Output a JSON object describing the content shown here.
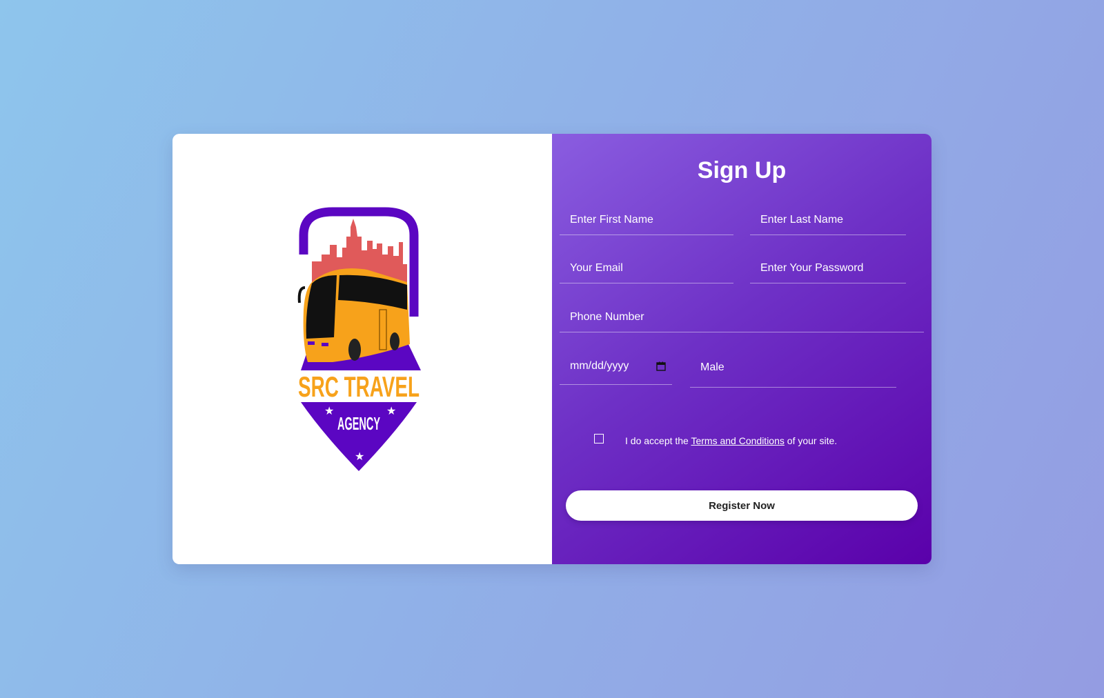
{
  "logo": {
    "brand_line1": "SRC TRAVEL",
    "brand_line2": "AGENCY"
  },
  "form": {
    "title": "Sign Up",
    "first_name_placeholder": "Enter First Name",
    "last_name_placeholder": "Enter Last Name",
    "email_placeholder": "Your Email",
    "password_placeholder": "Enter Your Password",
    "phone_placeholder": "Phone Number",
    "date_placeholder": "mm/dd/yyyy",
    "gender_value": "Male",
    "terms_prefix": "I do accept the ",
    "terms_link": "Terms and Conditions",
    "terms_suffix": " of your site.",
    "register_label": "Register Now"
  },
  "colors": {
    "panel_gradient_start": "#8a5de0",
    "panel_gradient_end": "#5a00aa",
    "logo_purple": "#5b06c2",
    "bus_yellow": "#f7a21b",
    "skyline_red": "#e05a5a"
  }
}
